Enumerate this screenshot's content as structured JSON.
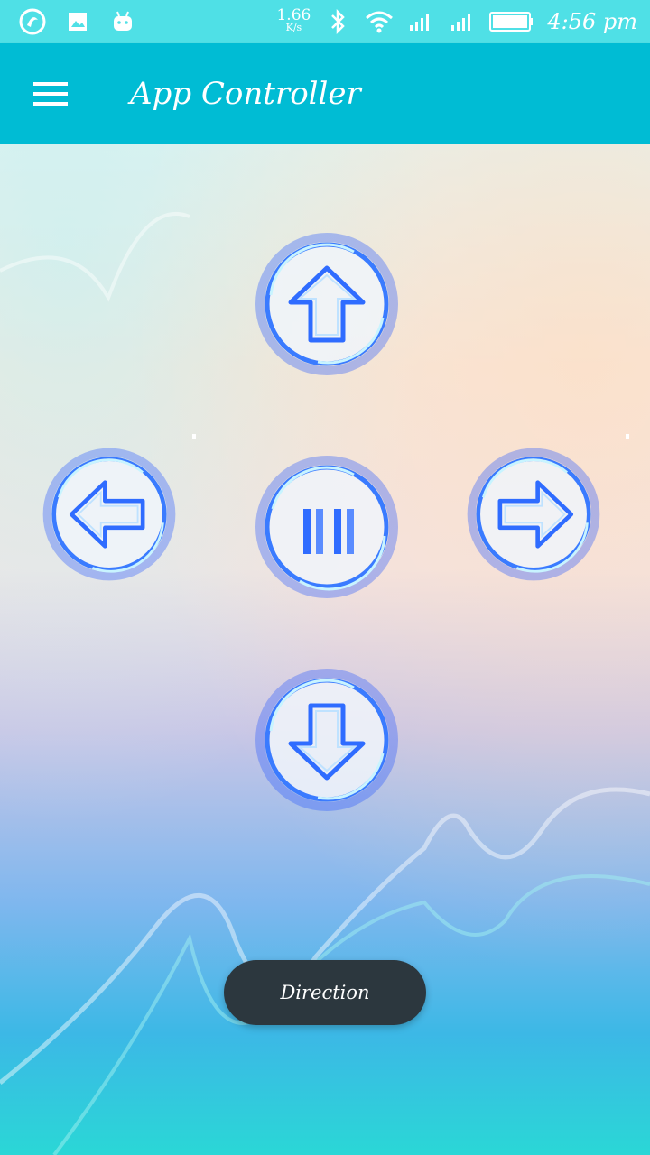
{
  "status_bar": {
    "net_speed": "1.66",
    "net_unit": "K/s",
    "time": "4:56 pm",
    "icons": [
      "app-logo-icon",
      "gallery-icon",
      "android-icon",
      "bluetooth-icon",
      "wifi-icon",
      "signal-icon",
      "signal-icon",
      "battery-icon"
    ]
  },
  "app_bar": {
    "title": "App Controller",
    "menu_icon": "hamburger-menu-icon"
  },
  "controls": {
    "up": "arrow-up-icon",
    "left": "arrow-left-icon",
    "center": "pause-icon",
    "right": "arrow-right-icon",
    "down": "arrow-down-icon"
  },
  "direction_button": {
    "label": "Direction"
  },
  "colors": {
    "status_bar": "#4fe0e6",
    "app_bar": "#00bcd4",
    "button_glow": "#2f6cff",
    "pill": "#2c373e"
  }
}
